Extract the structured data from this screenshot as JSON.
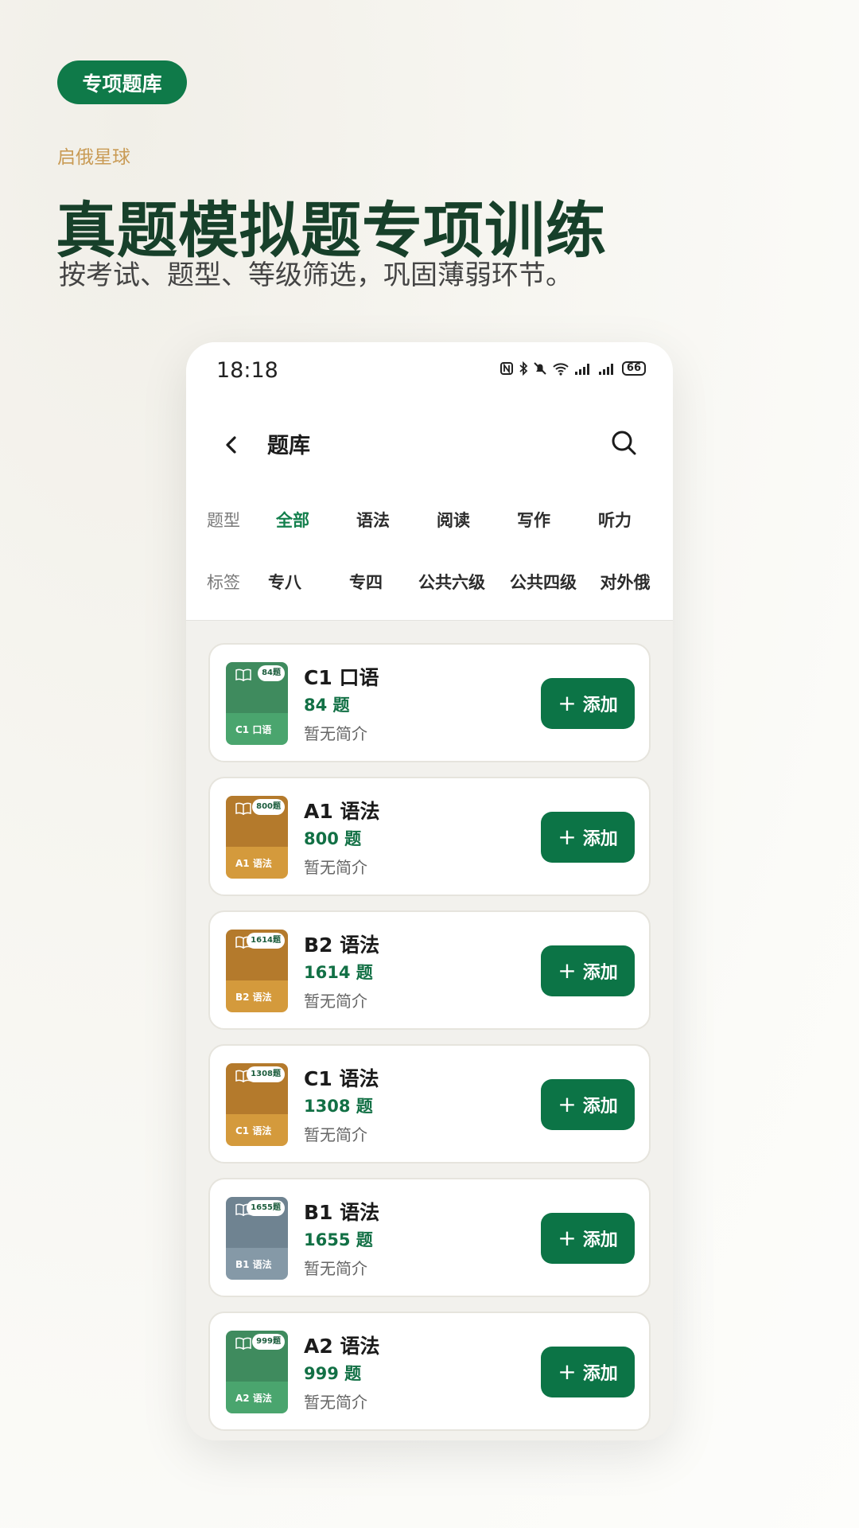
{
  "promo": {
    "pill": "专项题库",
    "brand": "启俄星球",
    "headline": "真题模拟题专项训练",
    "subline": "按考试、题型、等级筛选，巩固薄弱环节。"
  },
  "status": {
    "time": "18:18",
    "battery": "66"
  },
  "nav": {
    "title": "题库"
  },
  "filters": {
    "type_label": "题型",
    "types": [
      "全部",
      "语法",
      "阅读",
      "写作",
      "听力"
    ],
    "tag_label": "标签",
    "tags": [
      "专八",
      "专四",
      "公共六级",
      "公共四级",
      "对外俄"
    ]
  },
  "items": [
    {
      "title": "C1 口语",
      "count": "84 题",
      "badge": "84题",
      "cover_title": "C1 口语",
      "desc": "暂无简介",
      "add": "添加",
      "top_color": "#3f8b5e",
      "bottom_color": "#4aa56e"
    },
    {
      "title": "A1 语法",
      "count": "800 题",
      "badge": "800题",
      "cover_title": "A1 语法",
      "desc": "暂无简介",
      "add": "添加",
      "top_color": "#b47a2c",
      "bottom_color": "#d49a3c"
    },
    {
      "title": "B2 语法",
      "count": "1614 题",
      "badge": "1614题",
      "cover_title": "B2 语法",
      "desc": "暂无简介",
      "add": "添加",
      "top_color": "#b47a2c",
      "bottom_color": "#d49a3c"
    },
    {
      "title": "C1 语法",
      "count": "1308 题",
      "badge": "1308题",
      "cover_title": "C1 语法",
      "desc": "暂无简介",
      "add": "添加",
      "top_color": "#b47a2c",
      "bottom_color": "#d49a3c"
    },
    {
      "title": "B1 语法",
      "count": "1655 题",
      "badge": "1655题",
      "cover_title": "B1 语法",
      "desc": "暂无简介",
      "add": "添加",
      "top_color": "#6f8391",
      "bottom_color": "#8599a7"
    },
    {
      "title": "A2 语法",
      "count": "999 题",
      "badge": "999题",
      "cover_title": "A2 语法",
      "desc": "暂无简介",
      "add": "添加",
      "top_color": "#3f8b5e",
      "bottom_color": "#4aa56e"
    }
  ],
  "colors": {
    "accent": "#0c7446",
    "brand": "#c99b55",
    "headline": "#17402a"
  }
}
